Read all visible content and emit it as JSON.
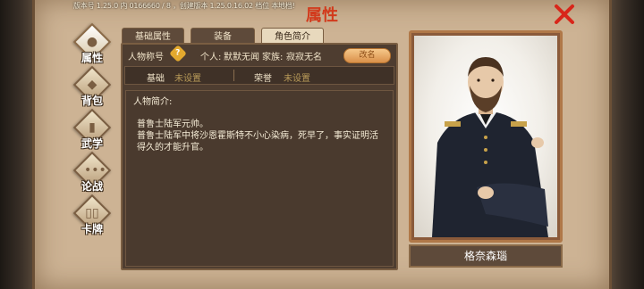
{
  "header": {
    "version": "版本号 1.25.0 内 0166660 / 8 ，创建版本 1.25.0.16.02 档位 本地档!",
    "title": "属性"
  },
  "sidebar": {
    "items": [
      {
        "label": "属性",
        "active": true
      },
      {
        "label": "背包",
        "active": false
      },
      {
        "label": "武学",
        "active": false
      },
      {
        "label": "论战",
        "active": false
      },
      {
        "label": "卡牌",
        "active": false
      }
    ]
  },
  "tabs": [
    {
      "label": "基础属性",
      "active": false
    },
    {
      "label": "装备",
      "active": false
    },
    {
      "label": "角色简介",
      "active": true
    }
  ],
  "profile": {
    "title_label": "人物称号",
    "help_symbol": "?",
    "personal_label": "个人:",
    "personal_value": "默默无闻",
    "family_label": "家族:",
    "family_value": "寂寂无名",
    "rename_label": "改名"
  },
  "attributes": {
    "basic_label": "基础",
    "basic_value": "未设置",
    "honor_label": "荣誉",
    "honor_value": "未设置"
  },
  "bio": {
    "heading": "人物简介:",
    "lines": [
      "普鲁士陆军元帅。",
      "普鲁士陆军中将沙恩霍斯特不小心染病，死早了，事实证明活",
      "得久的才能升官。"
    ]
  },
  "character": {
    "name": "格奈森瑙"
  },
  "colors": {
    "title_red": "#d23a1c",
    "close_red": "#d8261a",
    "panel_brown": "#4e3d30",
    "parchment": "#cdb394",
    "accent_gold": "#e3a92e"
  }
}
